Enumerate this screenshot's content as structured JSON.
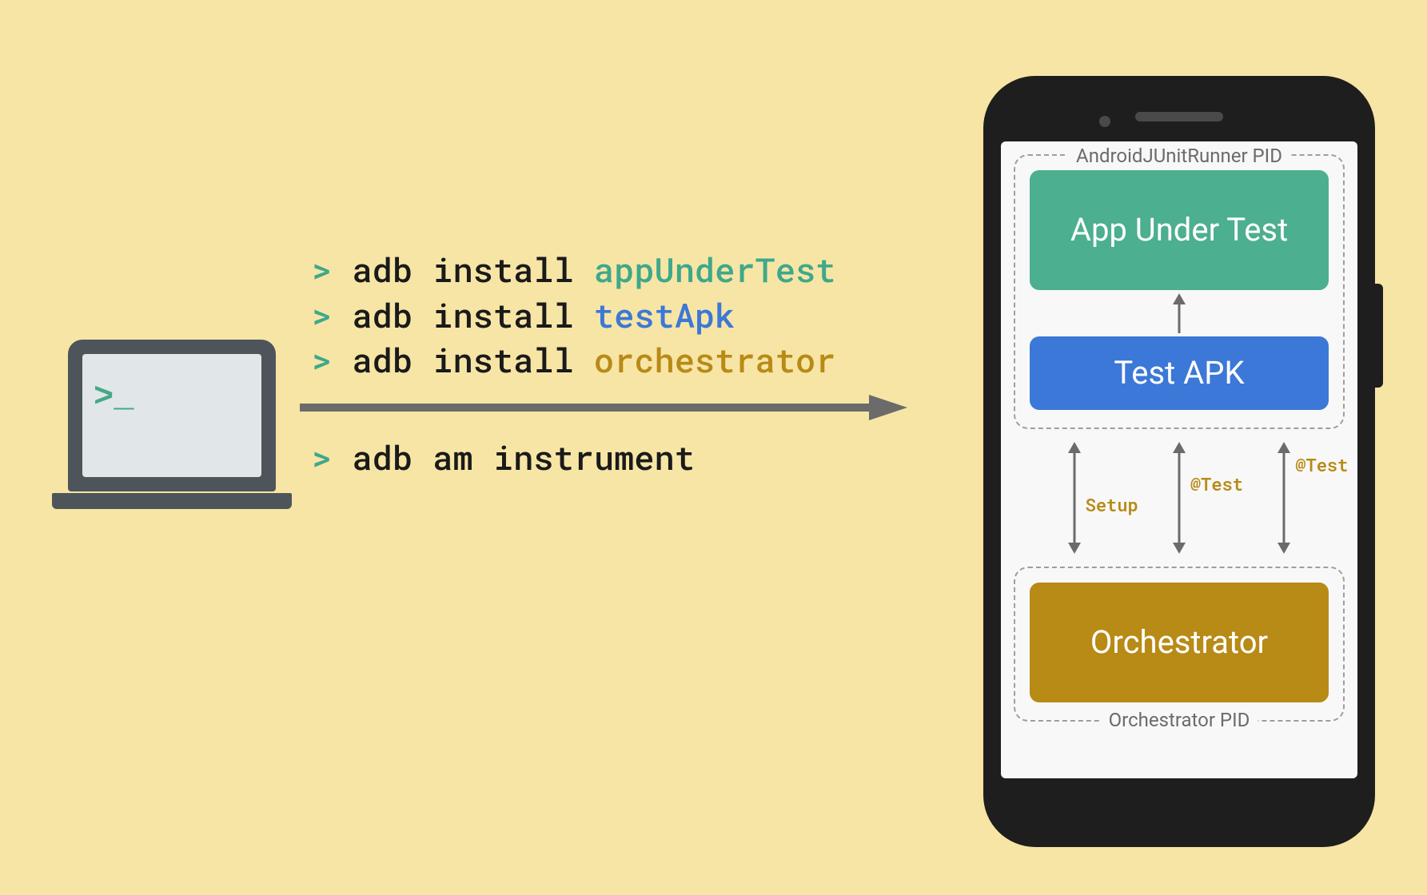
{
  "laptop": {
    "prompt": ">_"
  },
  "commands": {
    "prompt": ">",
    "lines": [
      {
        "cmd": "adb install",
        "arg": "appUnderTest",
        "argClass": "arg-green"
      },
      {
        "cmd": "adb install",
        "arg": "testApk",
        "argClass": "arg-blue"
      },
      {
        "cmd": "adb install",
        "arg": "orchestrator",
        "argClass": "arg-gold"
      }
    ],
    "belowArrow": {
      "cmd": "adb am instrument"
    }
  },
  "phone": {
    "group1": {
      "label": "AndroidJUnitRunner PID",
      "boxGreen": "App Under Test",
      "boxBlue": "Test APK"
    },
    "midLabels": [
      "Setup",
      "@Test",
      "@Test"
    ],
    "group2": {
      "label": "Orchestrator PID",
      "boxGold": "Orchestrator"
    }
  }
}
